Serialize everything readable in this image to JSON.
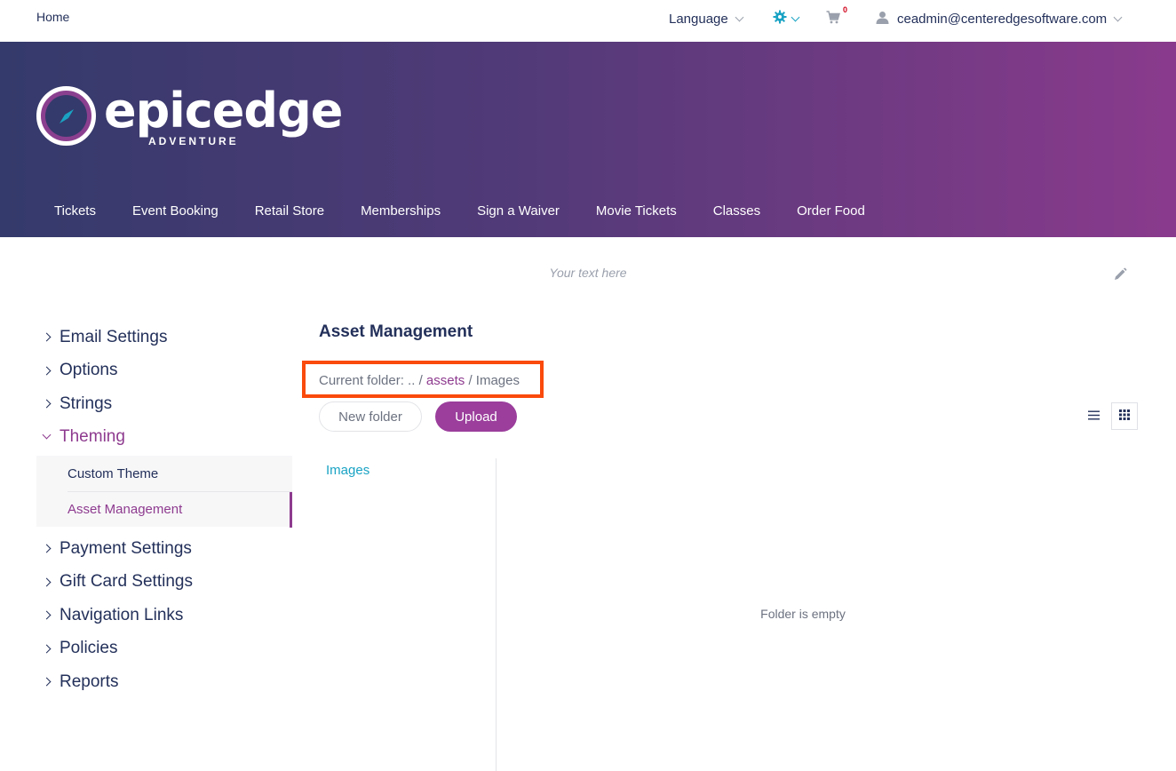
{
  "topbar": {
    "home": "Home",
    "language": "Language",
    "cart_count": "0",
    "user_email": "ceadmin@centeredgesoftware.com",
    "icons": {
      "settings": "gear-icon",
      "cart": "cart-icon",
      "user": "user-icon"
    }
  },
  "brand": {
    "word": "epicedge",
    "sub": "ADVENTURE"
  },
  "mainnav": {
    "items": [
      {
        "label": "Tickets"
      },
      {
        "label": "Event Booking"
      },
      {
        "label": "Retail Store"
      },
      {
        "label": "Memberships"
      },
      {
        "label": "Sign a Waiver"
      },
      {
        "label": "Movie Tickets"
      },
      {
        "label": "Classes"
      },
      {
        "label": "Order Food"
      }
    ]
  },
  "announcement": {
    "text": "Your text here"
  },
  "sidebar": {
    "items": [
      {
        "label": "Email Settings"
      },
      {
        "label": "Options"
      },
      {
        "label": "Strings"
      },
      {
        "label": "Theming",
        "open": true
      },
      {
        "label": "Payment Settings"
      },
      {
        "label": "Gift Card Settings"
      },
      {
        "label": "Navigation Links"
      },
      {
        "label": "Policies"
      },
      {
        "label": "Reports"
      }
    ],
    "theming_children": [
      {
        "label": "Custom Theme"
      },
      {
        "label": "Asset Management",
        "active": true
      }
    ]
  },
  "content": {
    "title": "Asset Management",
    "crumb_prefix": "Current folder: ..",
    "crumb_sep": "/",
    "crumb_link": "assets",
    "crumb_current": "Images",
    "new_folder": "New folder",
    "upload": "Upload",
    "tree_item": "Images",
    "empty_text": "Folder is empty"
  },
  "colors": {
    "accent": "#9b3e9c",
    "link_teal": "#1aa3c4",
    "highlight": "#fa4a0c",
    "navy": "#23305a"
  }
}
